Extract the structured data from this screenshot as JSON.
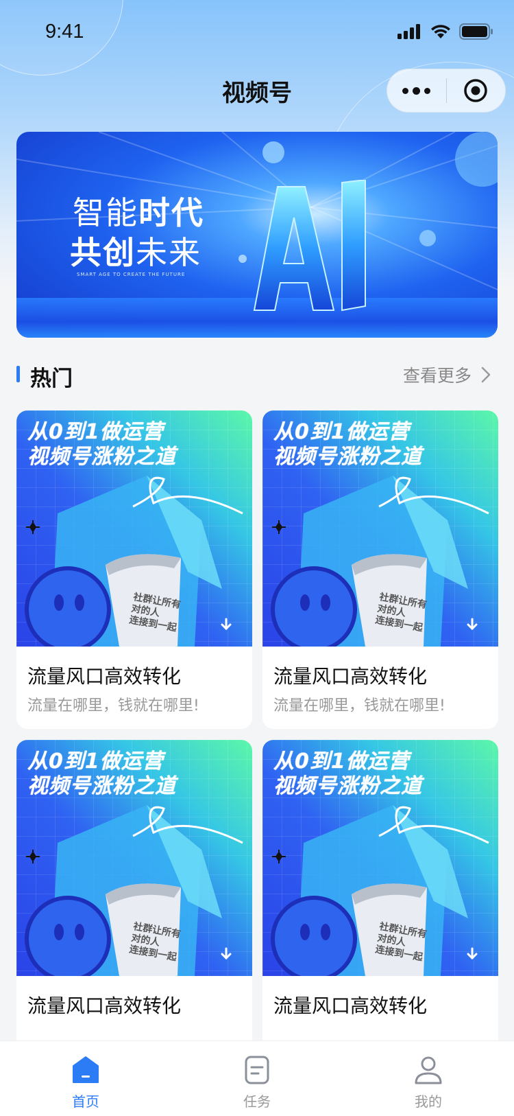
{
  "status_bar": {
    "time": "9:41"
  },
  "nav": {
    "title": "视频号"
  },
  "banner": {
    "line1_light": "智能",
    "line1_bold": "时代",
    "line2_bold": "共创",
    "line2_light": "未来",
    "subtitle": "SMART AGE TO CREATE THE FUTURE",
    "logo_text": "AI"
  },
  "section": {
    "title": "热门",
    "see_more": "查看更多"
  },
  "cards": [
    {
      "cover_line1": "从0到1做运营",
      "cover_line2": "视频号涨粉之道",
      "paper_line1": "社群让所有",
      "paper_line2": "对的人",
      "paper_line3": "连接到一起",
      "title": "流量风口高效转化",
      "subtitle": "流量在哪里，钱就在哪里!"
    },
    {
      "cover_line1": "从0到1做运营",
      "cover_line2": "视频号涨粉之道",
      "paper_line1": "社群让所有",
      "paper_line2": "对的人",
      "paper_line3": "连接到一起",
      "title": "流量风口高效转化",
      "subtitle": "流量在哪里，钱就在哪里!"
    },
    {
      "cover_line1": "从0到1做运营",
      "cover_line2": "视频号涨粉之道",
      "paper_line1": "社群让所有",
      "paper_line2": "对的人",
      "paper_line3": "连接到一起",
      "title": "流量风口高效转化",
      "subtitle": ""
    },
    {
      "cover_line1": "从0到1做运营",
      "cover_line2": "视频号涨粉之道",
      "paper_line1": "社群让所有",
      "paper_line2": "对的人",
      "paper_line3": "连接到一起",
      "title": "流量风口高效转化",
      "subtitle": ""
    }
  ],
  "tabbar": {
    "items": [
      {
        "label": "首页",
        "icon": "home-icon",
        "active": true
      },
      {
        "label": "任务",
        "icon": "task-icon",
        "active": false
      },
      {
        "label": "我的",
        "icon": "profile-icon",
        "active": false
      }
    ]
  },
  "colors": {
    "accent": "#2c7cf6",
    "text": "#111111",
    "muted": "#999999"
  }
}
